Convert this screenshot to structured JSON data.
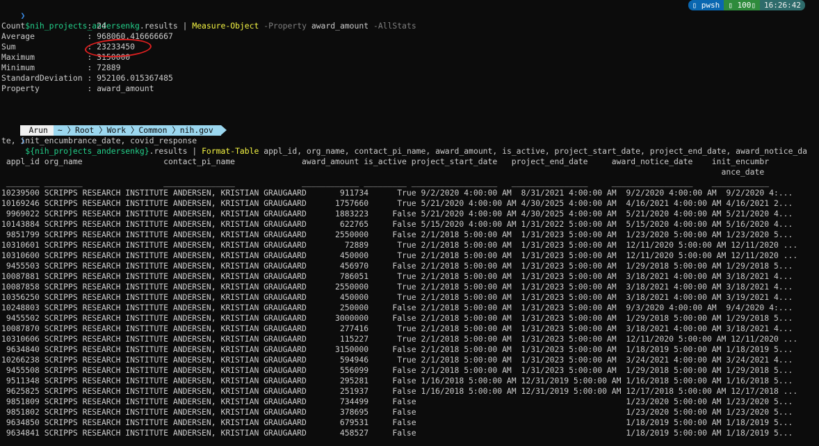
{
  "command1": {
    "prompt_glyph": "❯",
    "var": "$nih_projects_andersenkg",
    "member": ".results",
    "pipe": " | ",
    "cmdlet": "Measure-Object",
    "param1": "-Property",
    "arg1": "award_amount",
    "param2": "-AllStats"
  },
  "right_prompt": {
    "shell_icon": "terminal-icon",
    "shell": "pwsh",
    "exit_icon": "check-icon",
    "exit_code": "100",
    "time": "16:26:42"
  },
  "stats": [
    "Count             : 24",
    "Average           : 968060.416666667",
    "Sum               : 23233450",
    "Maximum           : 3150000",
    "Minimum           : 72889",
    "StandardDeviation : 952106.015367485",
    "Property          : award_amount"
  ],
  "prompt_bar": {
    "user": "Arun",
    "segments": [
      "~",
      "Root",
      "Work",
      "Common",
      "nih.gov"
    ]
  },
  "command2": {
    "prompt_glyph": "❯",
    "var": "${nih_projects_andersenkg}",
    "member": ".results",
    "pipe": " | ",
    "cmdlet": "Format-Table",
    "args_line1": " appl_id, org_name, contact_pi_name, award_amount, is_active, project_start_date, project_end_date, award_notice_da",
    "args_line2": "te, init_encumbrance_date, covid_response"
  },
  "table": {
    "header1": " appl_id org_name                 contact_pi_name              award_amount is_active project_start_date   project_end_date     award_notice_date    init_encumbr",
    "header2": "                                                                                                                                                       ance_date",
    "underline": " _______ ________                 _______________              ____________ _________ __________________   ________________     _________________    ____________",
    "rows": [
      "10239500 SCRIPPS RESEARCH INSTITUTE ANDERSEN, KRISTIAN GRAUGAARD       911734      True 9/2/2020 4:00:00 AM  8/31/2021 4:00:00 AM  9/2/2020 4:00:00 AM  9/2/2020 4:...",
      "10169246 SCRIPPS RESEARCH INSTITUTE ANDERSEN, KRISTIAN GRAUGAARD      1757660      True 5/21/2020 4:00:00 AM 4/30/2025 4:00:00 AM  4/16/2021 4:00:00 AM 4/16/2021 2...",
      " 9969022 SCRIPPS RESEARCH INSTITUTE ANDERSEN, KRISTIAN GRAUGAARD      1883223     False 5/21/2020 4:00:00 AM 4/30/2025 4:00:00 AM  5/21/2020 4:00:00 AM 5/21/2020 4...",
      "10143884 SCRIPPS RESEARCH INSTITUTE ANDERSEN, KRISTIAN GRAUGAARD       622765     False 5/15/2020 4:00:00 AM 1/31/2022 5:00:00 AM  5/15/2020 4:00:00 AM 5/16/2020 4...",
      " 9851799 SCRIPPS RESEARCH INSTITUTE ANDERSEN, KRISTIAN GRAUGAARD      2550000     False 2/1/2018 5:00:00 AM  1/31/2023 5:00:00 AM  1/23/2020 5:00:00 AM 1/23/2020 5...",
      "10310601 SCRIPPS RESEARCH INSTITUTE ANDERSEN, KRISTIAN GRAUGAARD        72889      True 2/1/2018 5:00:00 AM  1/31/2023 5:00:00 AM  12/11/2020 5:00:00 AM 12/11/2020 ...",
      "10310600 SCRIPPS RESEARCH INSTITUTE ANDERSEN, KRISTIAN GRAUGAARD       450000      True 2/1/2018 5:00:00 AM  1/31/2023 5:00:00 AM  12/11/2020 5:00:00 AM 12/11/2020 ...",
      " 9455503 SCRIPPS RESEARCH INSTITUTE ANDERSEN, KRISTIAN GRAUGAARD       456970     False 2/1/2018 5:00:00 AM  1/31/2023 5:00:00 AM  1/29/2018 5:00:00 AM 1/29/2018 5...",
      "10087881 SCRIPPS RESEARCH INSTITUTE ANDERSEN, KRISTIAN GRAUGAARD       786051      True 2/1/2018 5:00:00 AM  1/31/2023 5:00:00 AM  3/18/2021 4:00:00 AM 3/18/2021 4...",
      "10087858 SCRIPPS RESEARCH INSTITUTE ANDERSEN, KRISTIAN GRAUGAARD      2550000      True 2/1/2018 5:00:00 AM  1/31/2023 5:00:00 AM  3/18/2021 4:00:00 AM 3/18/2021 4...",
      "10356250 SCRIPPS RESEARCH INSTITUTE ANDERSEN, KRISTIAN GRAUGAARD       450000      True 2/1/2018 5:00:00 AM  1/31/2023 5:00:00 AM  3/18/2021 4:00:00 AM 3/19/2021 4...",
      "10248803 SCRIPPS RESEARCH INSTITUTE ANDERSEN, KRISTIAN GRAUGAARD       250000     False 2/1/2018 5:00:00 AM  1/31/2023 5:00:00 AM  9/3/2020 4:00:00 AM  9/4/2020 4:...",
      " 9455502 SCRIPPS RESEARCH INSTITUTE ANDERSEN, KRISTIAN GRAUGAARD      3000000     False 2/1/2018 5:00:00 AM  1/31/2023 5:00:00 AM  1/29/2018 5:00:00 AM 1/29/2018 5...",
      "10087870 SCRIPPS RESEARCH INSTITUTE ANDERSEN, KRISTIAN GRAUGAARD       277416      True 2/1/2018 5:00:00 AM  1/31/2023 5:00:00 AM  3/18/2021 4:00:00 AM 3/18/2021 4...",
      "10310606 SCRIPPS RESEARCH INSTITUTE ANDERSEN, KRISTIAN GRAUGAARD       115227      True 2/1/2018 5:00:00 AM  1/31/2023 5:00:00 AM  12/11/2020 5:00:00 AM 12/11/2020 ...",
      " 9634840 SCRIPPS RESEARCH INSTITUTE ANDERSEN, KRISTIAN GRAUGAARD      3150000     False 2/1/2018 5:00:00 AM  1/31/2023 5:00:00 AM  1/18/2019 5:00:00 AM 1/18/2019 5...",
      "10266238 SCRIPPS RESEARCH INSTITUTE ANDERSEN, KRISTIAN GRAUGAARD       594946      True 2/1/2018 5:00:00 AM  1/31/2023 5:00:00 AM  3/24/2021 4:00:00 AM 3/24/2021 4...",
      " 9455508 SCRIPPS RESEARCH INSTITUTE ANDERSEN, KRISTIAN GRAUGAARD       556099     False 2/1/2018 5:00:00 AM  1/31/2023 5:00:00 AM  1/29/2018 5:00:00 AM 1/29/2018 5...",
      " 9511348 SCRIPPS RESEARCH INSTITUTE ANDERSEN, KRISTIAN GRAUGAARD       295281     False 1/16/2018 5:00:00 AM 12/31/2019 5:00:00 AM 1/16/2018 5:00:00 AM 1/16/2018 5...",
      " 9625825 SCRIPPS RESEARCH INSTITUTE ANDERSEN, KRISTIAN GRAUGAARD       251937     False 1/16/2018 5:00:00 AM 12/31/2019 5:00:00 AM 12/17/2018 5:00:00 AM 12/17/2018 ...",
      " 9851809 SCRIPPS RESEARCH INSTITUTE ANDERSEN, KRISTIAN GRAUGAARD       734499     False                                            1/23/2020 5:00:00 AM 1/23/2020 5...",
      " 9851802 SCRIPPS RESEARCH INSTITUTE ANDERSEN, KRISTIAN GRAUGAARD       378695     False                                            1/23/2020 5:00:00 AM 1/23/2020 5...",
      " 9634850 SCRIPPS RESEARCH INSTITUTE ANDERSEN, KRISTIAN GRAUGAARD       679531     False                                            1/18/2019 5:00:00 AM 1/18/2019 5...",
      " 9634841 SCRIPPS RESEARCH INSTITUTE ANDERSEN, KRISTIAN GRAUGAARD       458527     False                                            1/18/2019 5:00:00 AM 1/18/2019 5..."
    ]
  },
  "annotation_color": "#e02020"
}
